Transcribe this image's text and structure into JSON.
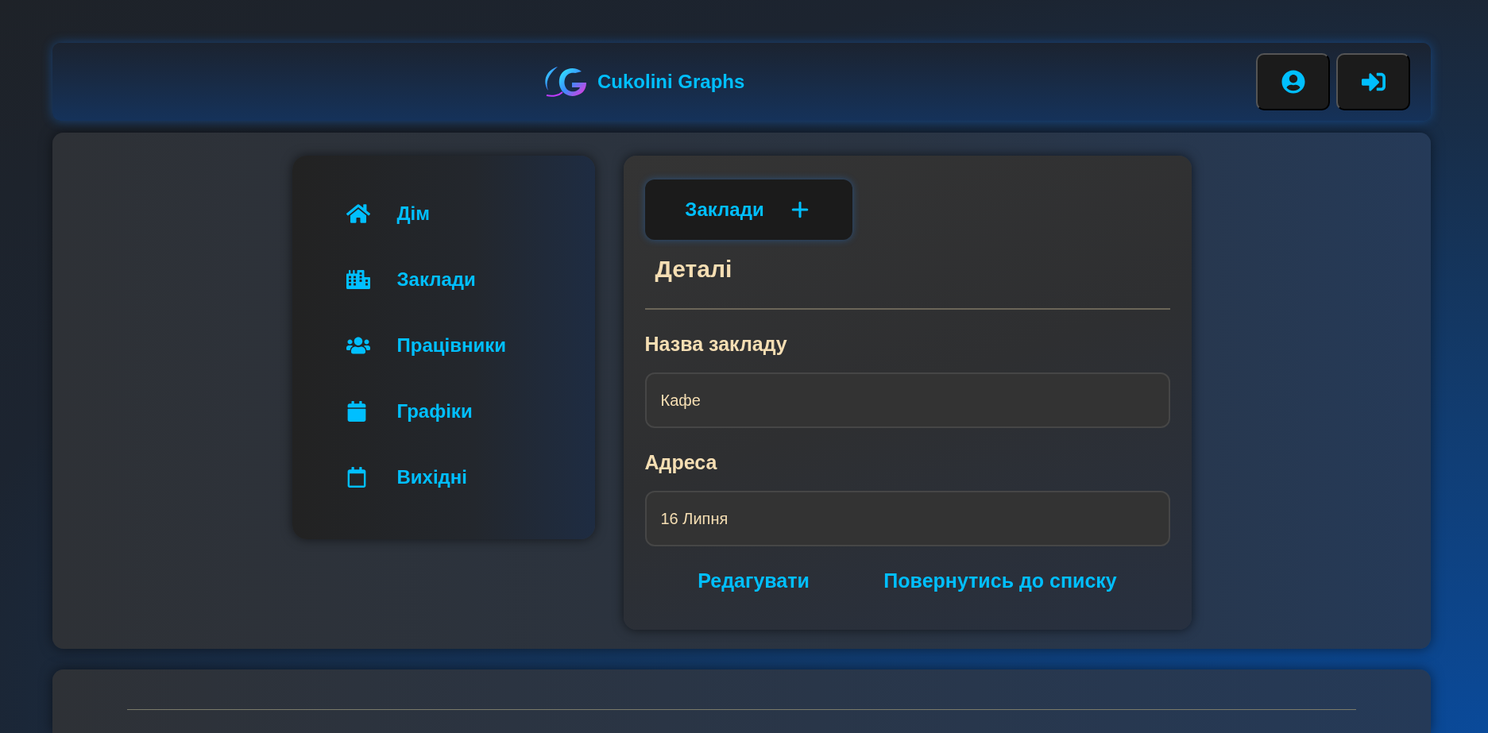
{
  "header": {
    "brand": "Cukolini Graphs",
    "buttons": [
      {
        "kind": "profile"
      },
      {
        "kind": "login"
      }
    ]
  },
  "sidebar": {
    "items": [
      {
        "label": "Дім",
        "kind": "home"
      },
      {
        "label": "Заклади",
        "kind": "buildings"
      },
      {
        "label": "Працівники",
        "kind": "people"
      },
      {
        "label": "Графіки",
        "kind": "calendar"
      },
      {
        "label": "Вихідні",
        "kind": "calendar-outline"
      }
    ]
  },
  "details": {
    "tab": {
      "label": "Заклади"
    },
    "title": "Деталі",
    "fields": [
      {
        "label": "Назва закладу",
        "value": "Кафе"
      },
      {
        "label": "Адреса",
        "value": "16 Липня"
      }
    ],
    "links": [
      "Редагувати",
      "Повернутись до списку"
    ]
  }
}
